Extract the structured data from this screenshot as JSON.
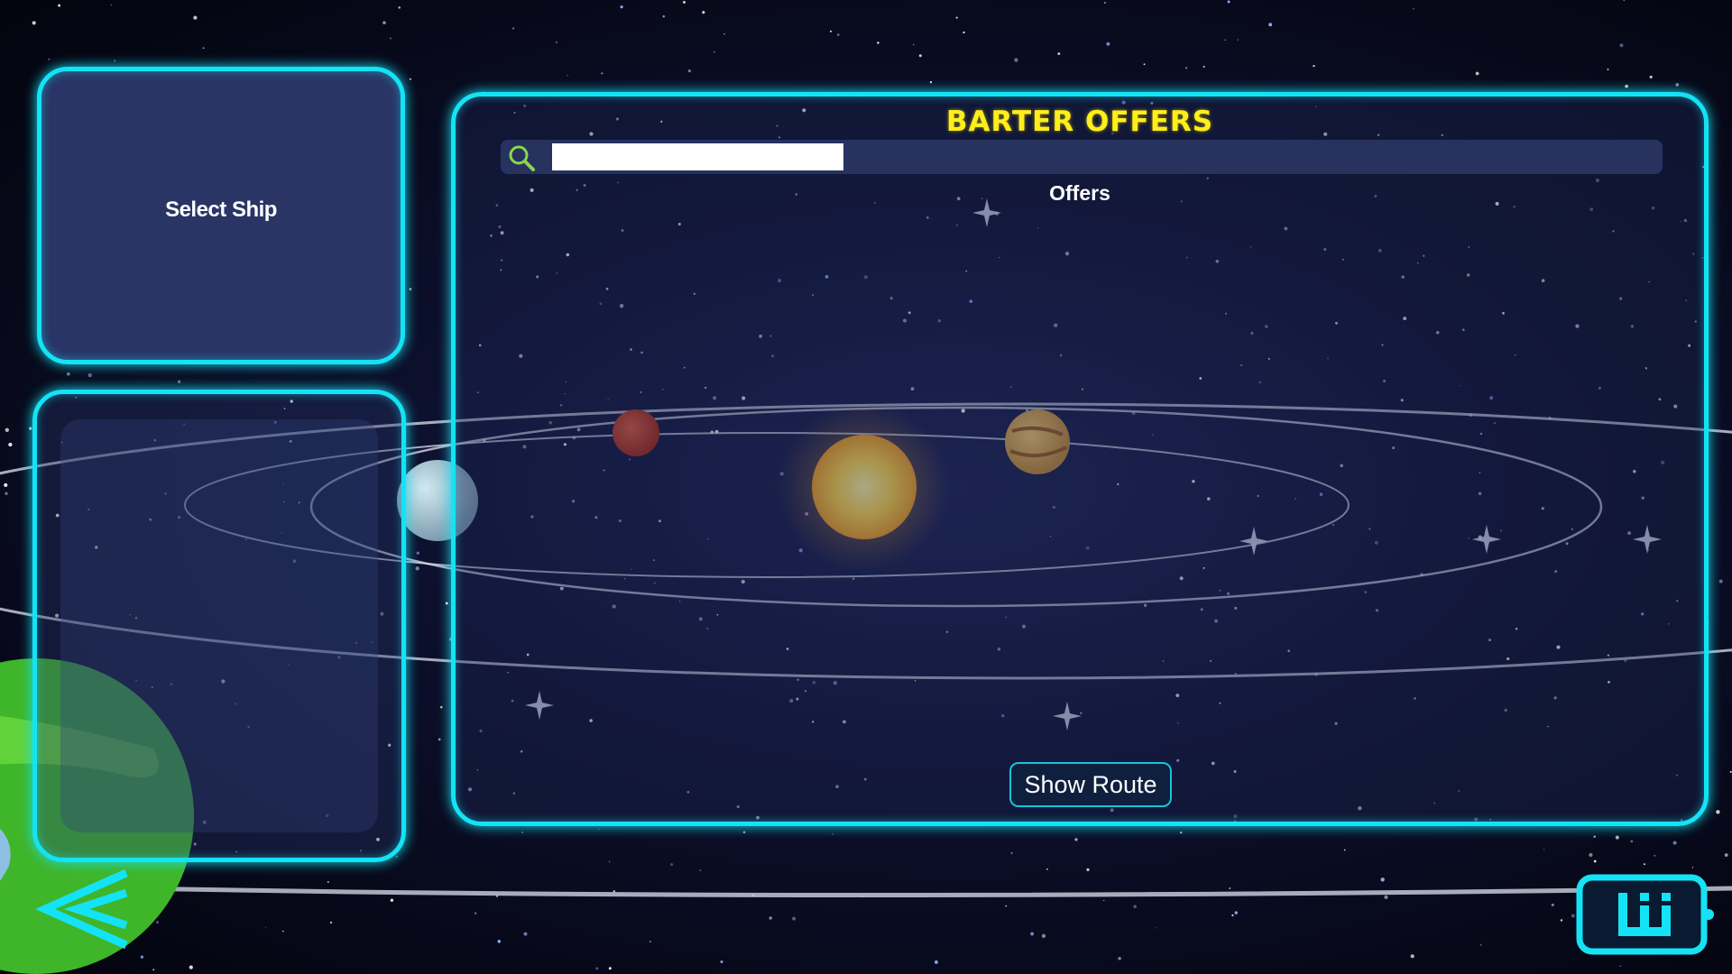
{
  "select_ship": {
    "label": "Select Ship"
  },
  "barter": {
    "title": "BARTER OFFERS",
    "search": {
      "value": "",
      "placeholder": ""
    },
    "offers_label": "Offers",
    "show_route_label": "Show Route"
  },
  "icons": {
    "search": "search-icon",
    "back": "double-chevron-left-icon",
    "hud": "inventory-bag-icon"
  },
  "colors": {
    "accent_cyan": "#14e3f5",
    "title_yellow": "#ffee1a",
    "panel_navy": "#2a3566",
    "search_icon_green": "#8bd64a"
  }
}
